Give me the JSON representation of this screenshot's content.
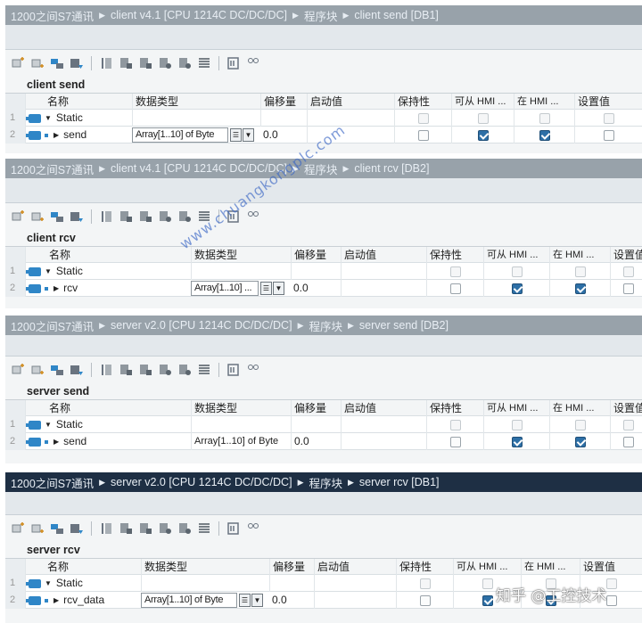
{
  "columns": {
    "name": "名称",
    "datatype": "数据类型",
    "offset": "偏移量",
    "start": "启动值",
    "retain": "保持性",
    "hmi_access": "可从 HMI ...",
    "hmi_visible": "在 HMI ...",
    "setpoint": "设置值"
  },
  "panels": [
    {
      "breadcrumb": [
        "1200之间S7通讯",
        "client v4.1 [CPU 1214C DC/DC/DC]",
        "程序块",
        "client send [DB1]"
      ],
      "block_name": "client send",
      "rows": [
        {
          "num": "1",
          "name": "Static",
          "type": "",
          "offset": ""
        },
        {
          "num": "2",
          "name": "send",
          "type": "Array[1..10] of Byte",
          "offset": "0.0",
          "retain": false,
          "hmi_access": true,
          "hmi_visible": true,
          "setpoint": false
        }
      ]
    },
    {
      "breadcrumb": [
        "1200之间S7通讯",
        "client v4.1 [CPU 1214C DC/DC/DC]",
        "程序块",
        "client rcv [DB2]"
      ],
      "block_name": "client rcv",
      "rows": [
        {
          "num": "1",
          "name": "Static",
          "type": "",
          "offset": ""
        },
        {
          "num": "2",
          "name": "rcv",
          "type": "Array[1..10] ...",
          "offset": "0.0",
          "retain": false,
          "hmi_access": true,
          "hmi_visible": true,
          "setpoint": false
        }
      ]
    },
    {
      "breadcrumb": [
        "1200之间S7通讯",
        "server v2.0 [CPU 1214C DC/DC/DC]",
        "程序块",
        "server send [DB2]"
      ],
      "block_name": "server send",
      "rows": [
        {
          "num": "1",
          "name": "Static",
          "type": "",
          "offset": ""
        },
        {
          "num": "2",
          "name": "send",
          "type": "Array[1..10] of Byte",
          "offset": "0.0",
          "retain": false,
          "hmi_access": true,
          "hmi_visible": true,
          "setpoint": false
        }
      ]
    },
    {
      "breadcrumb": [
        "1200之间S7通讯",
        "server v2.0 [CPU 1214C DC/DC/DC]",
        "程序块",
        "server rcv [DB1]"
      ],
      "block_name": "server rcv",
      "rows": [
        {
          "num": "1",
          "name": "Static",
          "type": "",
          "offset": ""
        },
        {
          "num": "2",
          "name": "rcv_data",
          "type": "Array[1..10] of Byte",
          "offset": "0.0",
          "retain": false,
          "hmi_access": true,
          "hmi_visible": true,
          "setpoint": false
        }
      ]
    }
  ],
  "toolbar_icons": [
    "insert-row-icon",
    "add-row-icon",
    "expand-icon",
    "collapse-icon",
    "snapshot-icon",
    "copy-snapshot-icon",
    "copy-start-values-icon",
    "load-start-values-icon",
    "load-snapshot-icon",
    "list-view-icon",
    "monitor-icon",
    "watch-icon"
  ],
  "watermark": "www.chuangkongplc.com",
  "footer_watermark": "知乎 @工控技术",
  "colors": {
    "title_grey": "#98a2aa",
    "title_dark": "#1e2f44",
    "checkbox_on": "#2d6fa6",
    "db_icon": "#2f86c7"
  }
}
